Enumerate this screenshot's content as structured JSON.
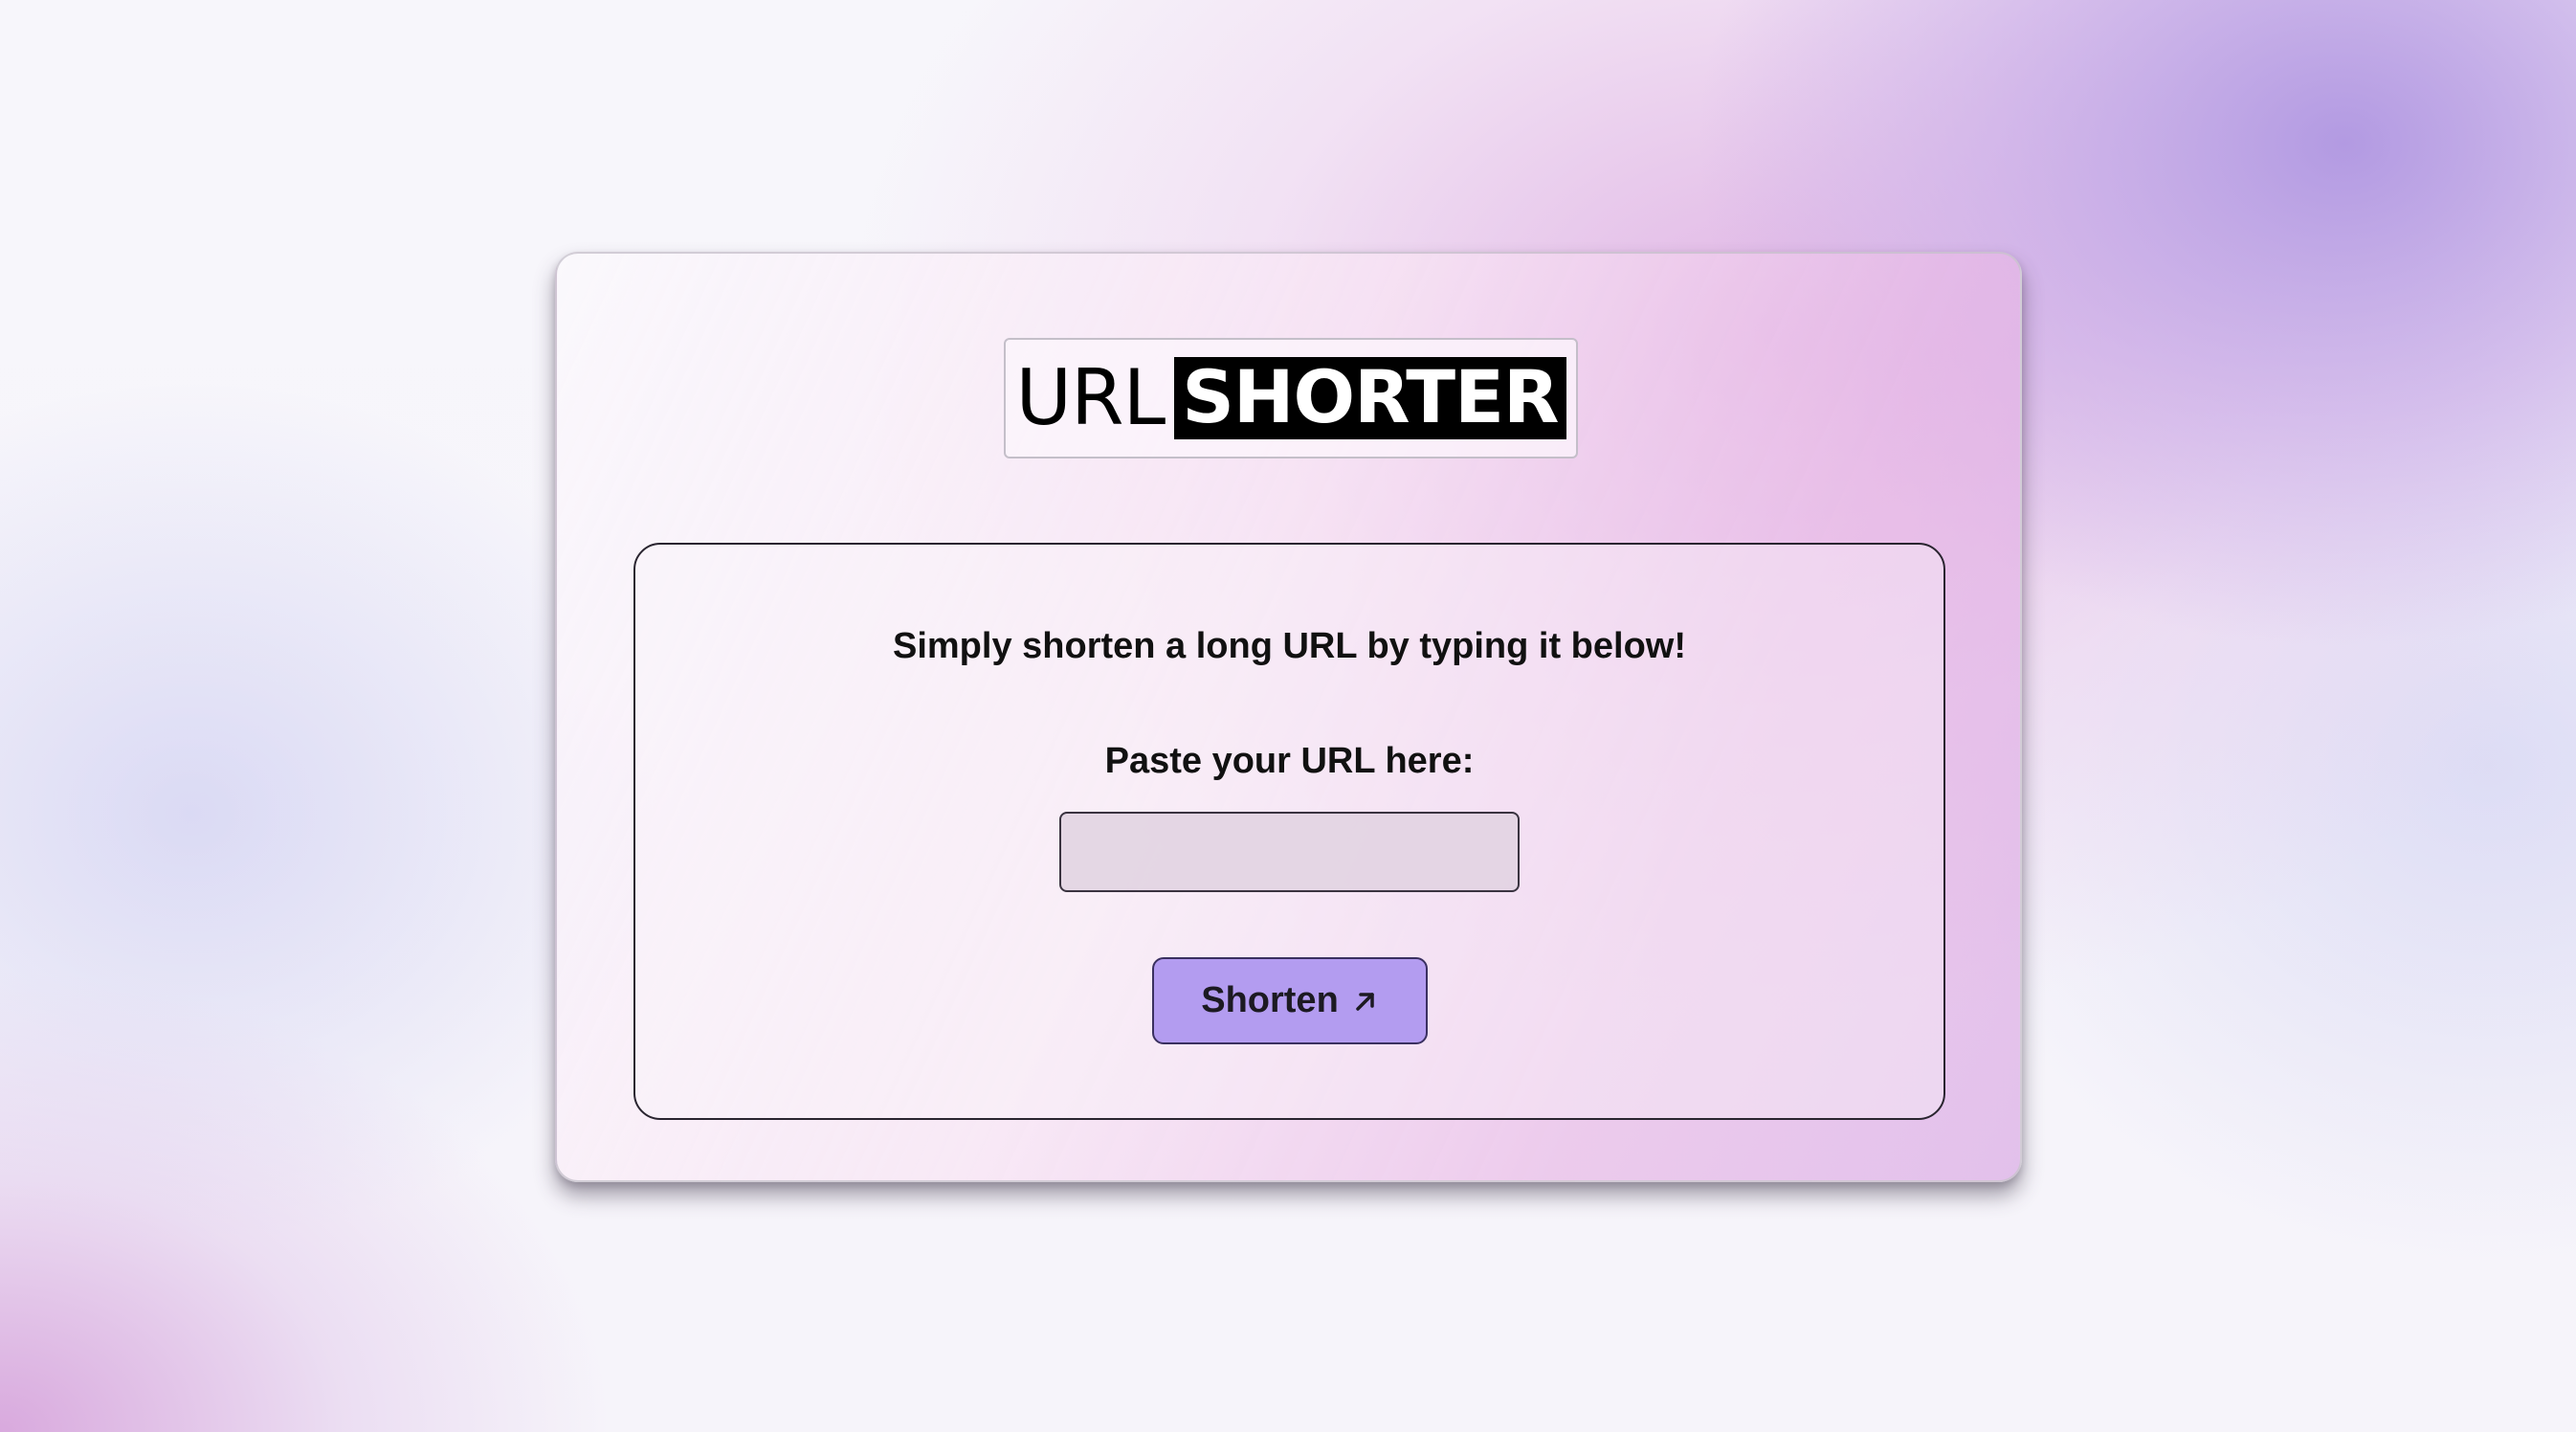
{
  "logo": {
    "part1": "URL",
    "part2": "SHORTER"
  },
  "form": {
    "tagline": "Simply shorten a long URL by typing it below!",
    "url_label": "Paste your URL here:",
    "url_value": "",
    "url_placeholder": "",
    "submit_label": "Shorten",
    "submit_icon": "arrow-up-right-icon"
  },
  "colors": {
    "button": "#b39cf0",
    "input": "#e1d2e1",
    "logo_highlight": "#000000"
  }
}
